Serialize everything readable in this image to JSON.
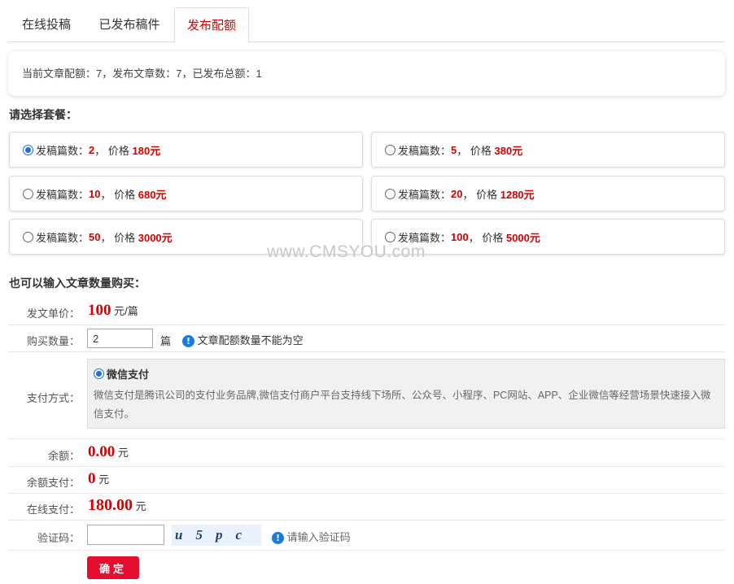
{
  "tabs": [
    {
      "label": "在线投稿",
      "active": false
    },
    {
      "label": "已发布稿件",
      "active": false
    },
    {
      "label": "发布配额",
      "active": true
    }
  ],
  "summary": {
    "text": "当前文章配额：7，发布文章数：7，已发布总额：1"
  },
  "packages": {
    "title": "请选择套餐：",
    "count_label": "发稿篇数：",
    "price_label": "， 价格",
    "items": [
      {
        "count": "2",
        "price": "180元",
        "selected": true
      },
      {
        "count": "5",
        "price": "380元",
        "selected": false
      },
      {
        "count": "10",
        "price": "680元",
        "selected": false
      },
      {
        "count": "20",
        "price": "1280元",
        "selected": false
      },
      {
        "count": "50",
        "price": "3000元",
        "selected": false
      },
      {
        "count": "100",
        "price": "5000元",
        "selected": false
      }
    ]
  },
  "watermark": "www.CMSYOU.com",
  "custom": {
    "title": "也可以输入文章数量购买：",
    "unit_price_label": "发文单价：",
    "unit_price_value": "100",
    "unit_price_unit": "元/篇",
    "quantity_label": "购买数量：",
    "quantity_value": "2",
    "quantity_unit": "篇",
    "quantity_hint": "文章配额数量不能为空",
    "payment_label": "支付方式：",
    "payment_option": "微信支付",
    "payment_desc": "微信支付是腾讯公司的支付业务品牌,微信支付商户平台支持线下场所、公众号、小程序、PC网站、APP、企业微信等经营场景快速接入微信支付。",
    "balance_label": "余额：",
    "balance_value": "0.00",
    "balance_pay_label": "余额支付：",
    "balance_pay_value": "0",
    "online_pay_label": "在线支付：",
    "online_pay_value": "180.00",
    "currency": "元",
    "captcha_label": "验证码：",
    "captcha_text": "u5pc",
    "captcha_hint": "请输入验证码",
    "submit_label": "确定"
  },
  "colors": {
    "accent_red": "#d50000",
    "button_red": "#e60d2e",
    "info_blue": "#1e7ad8"
  }
}
